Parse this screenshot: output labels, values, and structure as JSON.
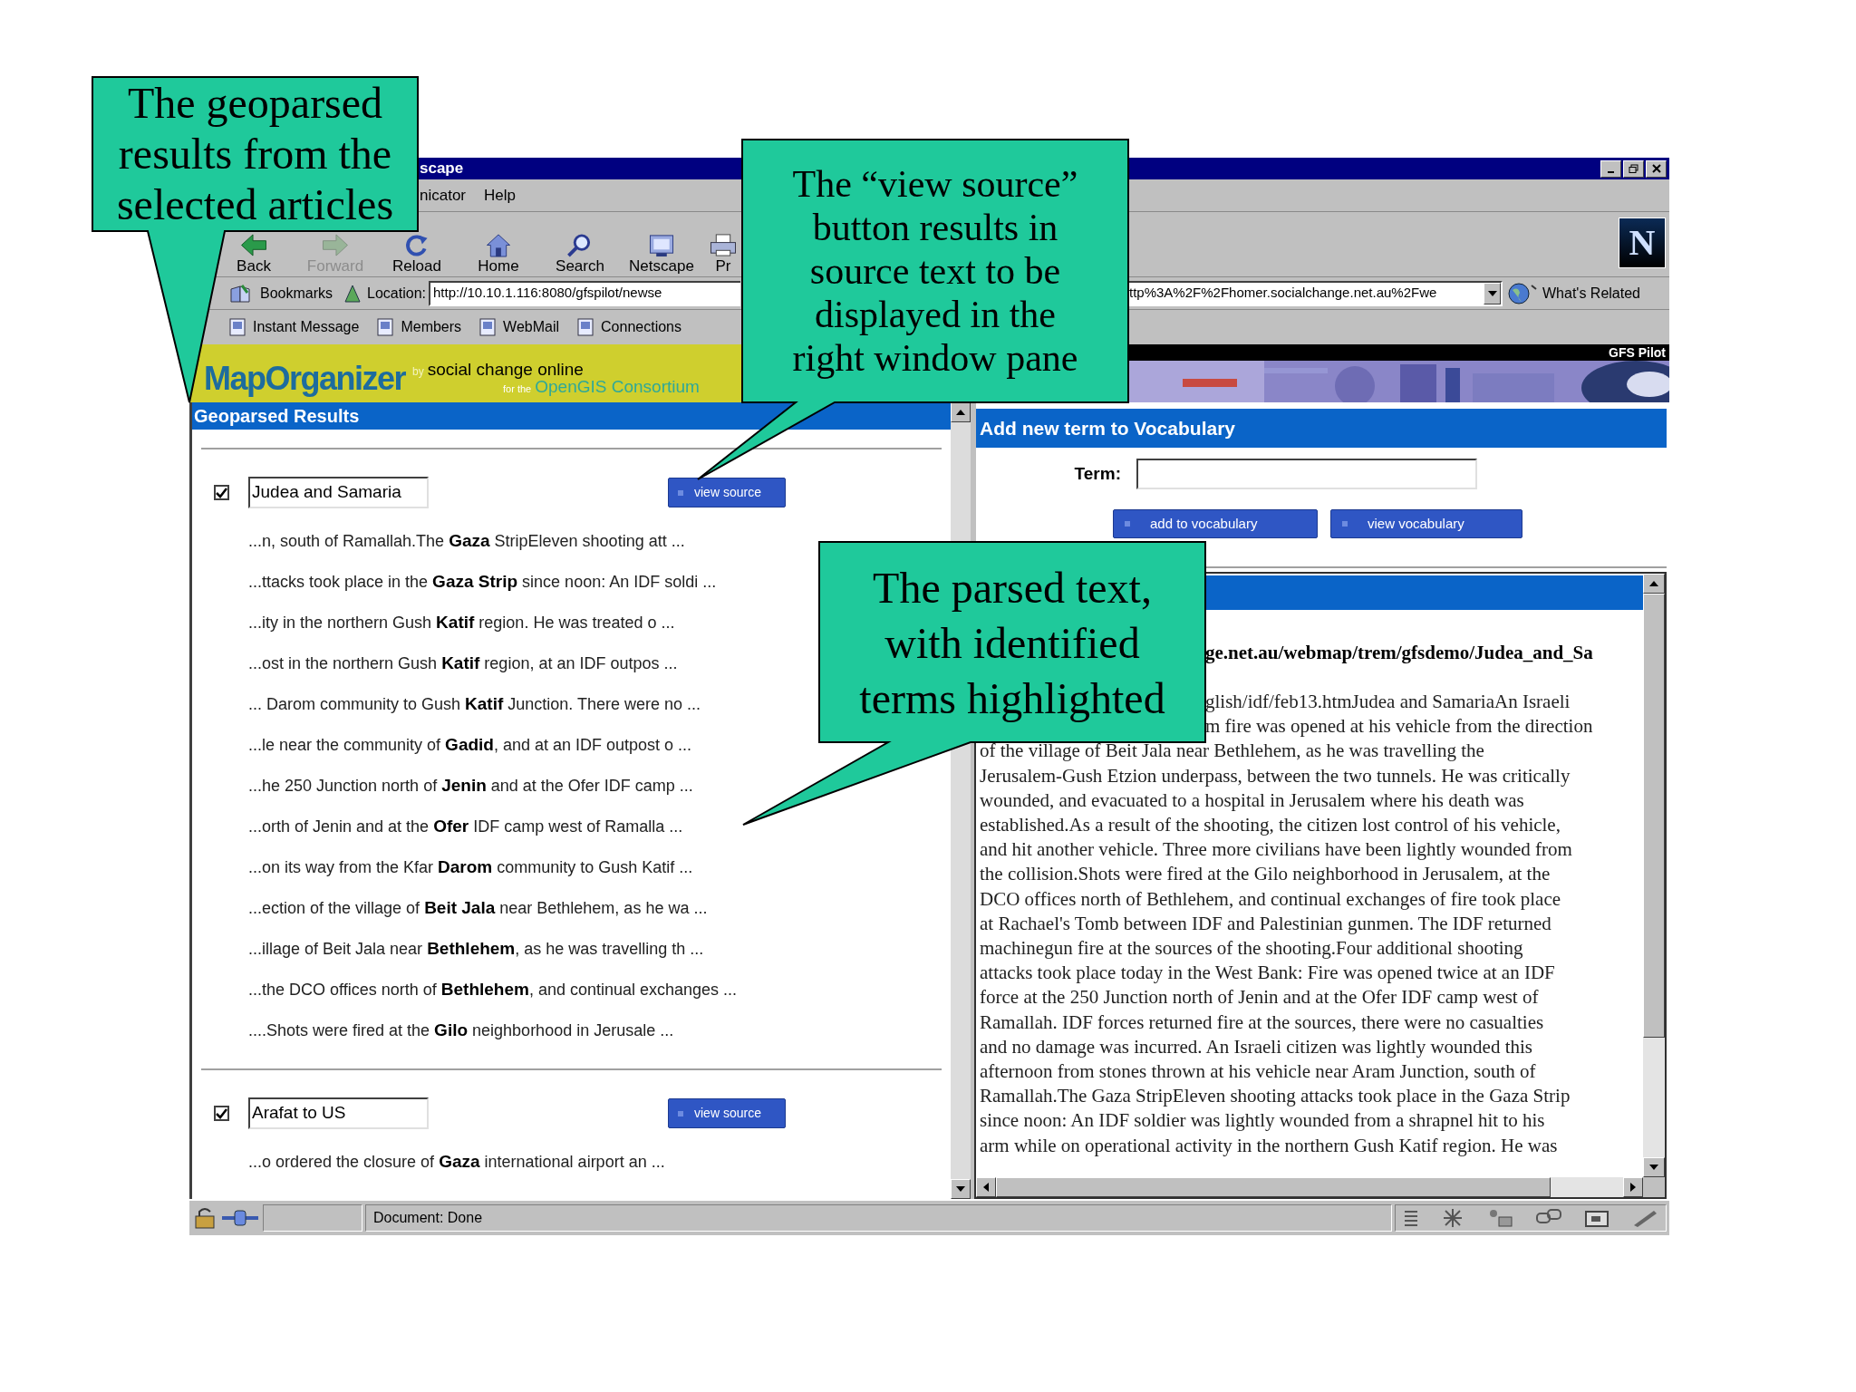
{
  "window": {
    "title": "scape"
  },
  "menu": [
    "nicator",
    "Help"
  ],
  "toolbar": [
    {
      "label": "Back",
      "kind": "back",
      "disabled": false
    },
    {
      "label": "Forward",
      "kind": "forward",
      "disabled": true
    },
    {
      "label": "Reload",
      "kind": "reload",
      "disabled": false
    },
    {
      "label": "Home",
      "kind": "home",
      "disabled": false
    },
    {
      "label": "Search",
      "kind": "search",
      "disabled": false
    },
    {
      "label": "Netscape",
      "kind": "portal",
      "disabled": false
    },
    {
      "label": "Pr",
      "kind": "print",
      "disabled": false
    }
  ],
  "throbber": "N",
  "location_bar": {
    "bookmarks": "Bookmarks",
    "label": "Location:",
    "url_start": "http://10.10.1.116:8080/gfspilot/newse",
    "url_end": "ttp%3A%2F%2Fhomer.socialchange.net.au%2Fwe",
    "related": "What's Related"
  },
  "personal_toolbar": [
    "Instant Message",
    "Members",
    "WebMail",
    "Connections"
  ],
  "banner": {
    "logo": "MapOrganizer",
    "by": "by",
    "tagline": "social change online",
    "for": "for the",
    "consortium": "OpenGIS Consortium",
    "pilot": "GFS Pilot"
  },
  "left_frame": {
    "title": "Geoparsed Results",
    "articles": [
      {
        "checked": true,
        "title": "Judea and Samaria",
        "button": "view source",
        "snippets": [
          "...n, south of Ramallah.The **Gaza** StripEleven shooting att ...",
          "...ttacks took place in the **Gaza Strip** since noon: An IDF soldi ...",
          "...ity in the northern Gush **Katif** region. He was treated o ...",
          "...ost in the northern Gush **Katif** region, at an IDF outpos ...",
          "... Darom community to Gush **Katif** Junction. There were no ...",
          "...le near the community of **Gadid**, and at an IDF outpost o ...",
          "...he 250 Junction north of **Jenin** and at the Ofer IDF camp ...",
          "...orth of Jenin and at the **Ofer** IDF camp west of Ramalla ...",
          "...on its way from the Kfar **Darom** community to Gush Katif ...",
          "...ection of the village of **Beit Jala** near Bethlehem, as he wa ...",
          "...illage of Beit Jala near **Bethlehem**, as he was travelling th ...",
          "...the DCO offices north of **Bethlehem**, and continual exchanges ...",
          "....Shots were fired at the **Gilo** neighborhood in Jerusale ..."
        ]
      },
      {
        "checked": true,
        "title": "Arafat to US",
        "button": "view source",
        "snippets": [
          "...o ordered the closure of **Gaza** international airport an ..."
        ]
      }
    ]
  },
  "right_frame": {
    "title": "Add new term to Vocabulary",
    "term_label": "Term:",
    "buttons": [
      "add to vocabulary",
      "view vocabulary"
    ],
    "source": {
      "url": "ge.net.au/webmap/trem/gfsdemo/Judea_and_Sa",
      "lead_lines": [
        "glish/idf/feb13.htmJudea and SamariaAn Israeli",
        "m fire was opened at his vehicle from the direction"
      ],
      "lines": [
        "of the village of Beit Jala near Bethlehem, as he was travelling the",
        "Jerusalem-Gush Etzion underpass, between the two tunnels. He was critically",
        "wounded, and evacuated to a hospital in Jerusalem where his death was",
        "established.As a result of the shooting, the citizen lost control of his vehicle,",
        "and hit another vehicle. Three more civilians have been lightly wounded from",
        "the collision.Shots were fired at the Gilo neighborhood in Jerusalem, at the",
        "DCO offices north of Bethlehem, and continual exchanges of fire took place",
        "at Rachael's Tomb between IDF and Palestinian gunmen. The IDF returned",
        "machinegun fire at the sources of the shooting.Four additional shooting",
        "attacks took place today in the West Bank: Fire was opened twice at an IDF",
        "force at the 250 Junction north of Jenin and at the Ofer IDF camp west of",
        "Ramallah. IDF forces returned fire at the sources, there were no casualties",
        "and no damage was incurred. An Israeli citizen was lightly wounded this",
        "afternoon from stones thrown at his vehicle near Aram Junction, south of",
        "Ramallah.The Gaza StripEleven shooting attacks took place in the Gaza Strip",
        "since noon: An IDF soldier was lightly wounded from a shrapnel hit to his",
        "arm while on operational activity in the northern Gush Katif region. He was"
      ]
    }
  },
  "status_bar": {
    "text": "Document: Done"
  },
  "callouts": [
    {
      "lines": [
        "The geoparsed",
        "results from the",
        "selected articles"
      ]
    },
    {
      "lines": [
        "The “view source”",
        "button results in",
        "source text to be",
        "displayed in the",
        "right window pane"
      ]
    },
    {
      "lines": [
        "The parsed text,",
        "with identified",
        "terms highlighted"
      ]
    }
  ]
}
